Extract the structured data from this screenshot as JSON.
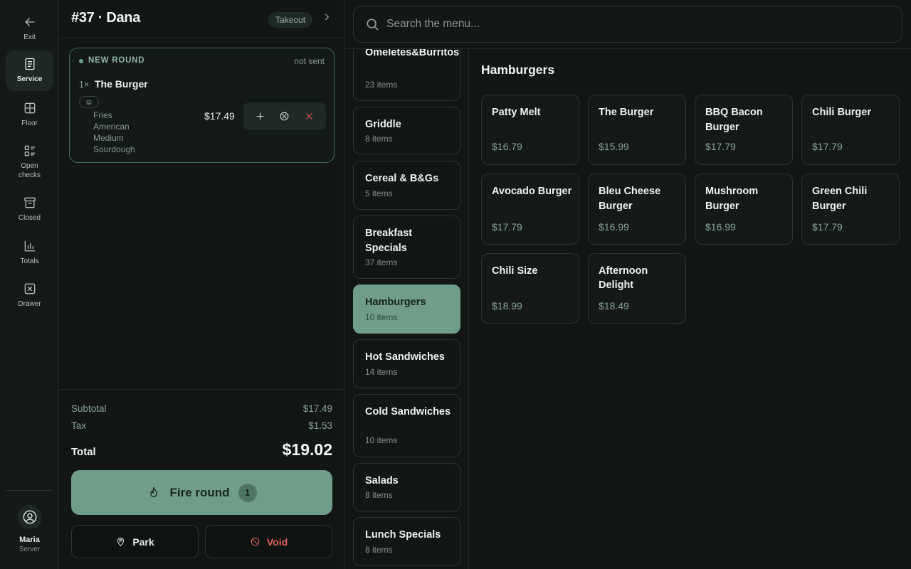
{
  "nav": {
    "items": [
      {
        "label": "Exit",
        "icon": "arrow-left-icon"
      },
      {
        "label": "Service",
        "icon": "receipt-icon"
      },
      {
        "label": "Floor",
        "icon": "grid-icon"
      },
      {
        "label": "Open\nchecks",
        "icon": "list-icon"
      },
      {
        "label": "Closed",
        "icon": "archive-icon"
      },
      {
        "label": "Totals",
        "icon": "bar-chart-icon"
      },
      {
        "label": "Drawer",
        "icon": "drawer-icon"
      }
    ],
    "active": "Service"
  },
  "user": {
    "name": "Maria",
    "role": "Server"
  },
  "order": {
    "title": "#37 · Dana",
    "type_badge": "Takeout",
    "round": {
      "label": "NEW ROUND",
      "status": "not sent",
      "line": {
        "qty": "1×",
        "name": "The Burger",
        "modifiers": [
          "Fries",
          "American",
          "Medium",
          "Sourdough"
        ],
        "price": "$17.49"
      }
    },
    "totals": {
      "subtotal_label": "Subtotal",
      "subtotal": "$17.49",
      "tax_label": "Tax",
      "tax": "$1.53",
      "total_label": "Total",
      "total": "$19.02"
    },
    "fire": {
      "label": "Fire round",
      "count": "1"
    },
    "park_label": "Park",
    "void_label": "Void"
  },
  "search": {
    "placeholder": "Search the menu..."
  },
  "categories": [
    {
      "name": "Omeletes&Burritos",
      "count": "23 items"
    },
    {
      "name": "Griddle",
      "count": "8 items"
    },
    {
      "name": "Cereal & B&Gs",
      "count": "5 items"
    },
    {
      "name": "Breakfast Specials",
      "count": "37 items"
    },
    {
      "name": "Hamburgers",
      "count": "10 items"
    },
    {
      "name": "Hot Sandwiches",
      "count": "14 items"
    },
    {
      "name": "Cold Sandwiches",
      "count": "10 items"
    },
    {
      "name": "Salads",
      "count": "8 items"
    },
    {
      "name": "Lunch Specials",
      "count": "8 items"
    }
  ],
  "active_category": "Hamburgers",
  "menu": {
    "title": "Hamburgers",
    "items": [
      {
        "name": "Patty Melt",
        "price": "$16.79"
      },
      {
        "name": "The Burger",
        "price": "$15.99"
      },
      {
        "name": "BBQ Bacon Burger",
        "price": "$17.79"
      },
      {
        "name": "Chili Burger",
        "price": "$17.79"
      },
      {
        "name": "Avocado Burger",
        "price": "$17.79"
      },
      {
        "name": "Bleu Cheese Burger",
        "price": "$16.99"
      },
      {
        "name": "Mushroom Burger",
        "price": "$16.99"
      },
      {
        "name": "Green Chili Burger",
        "price": "$17.79"
      },
      {
        "name": "Chili Size",
        "price": "$18.99"
      },
      {
        "name": "Afternoon Delight",
        "price": "$18.49"
      }
    ]
  },
  "colors": {
    "accent": "#6f9d89",
    "danger": "#e0605a",
    "background": "#121614"
  }
}
